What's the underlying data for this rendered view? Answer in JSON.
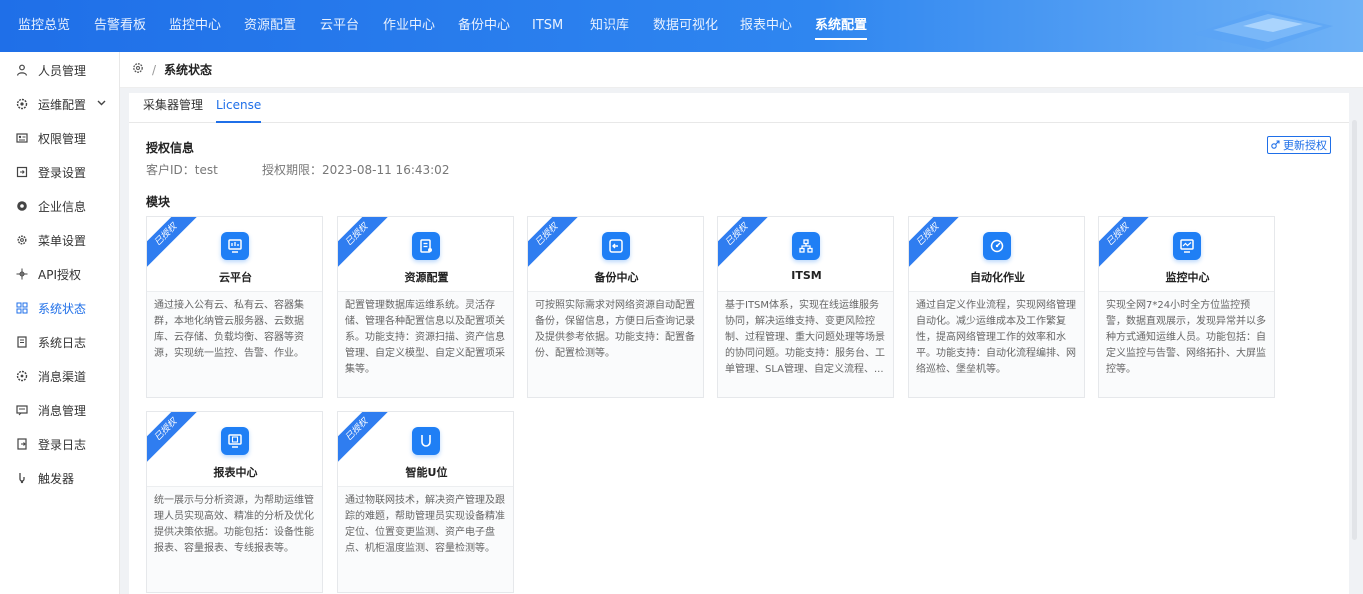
{
  "nav": {
    "items": [
      "监控总览",
      "告警看板",
      "监控中心",
      "资源配置",
      "云平台",
      "作业中心",
      "备份中心",
      "ITSM",
      "知识库",
      "数据可视化",
      "报表中心",
      "系统配置"
    ],
    "active_index": 11
  },
  "sidebar": {
    "items": [
      {
        "label": "人员管理",
        "icon": "user-icon"
      },
      {
        "label": "运维配置",
        "icon": "gear-icon"
      },
      {
        "label": "权限管理",
        "icon": "permission-icon"
      },
      {
        "label": "登录设置",
        "icon": "login-icon"
      },
      {
        "label": "企业信息",
        "icon": "company-icon"
      },
      {
        "label": "菜单设置",
        "icon": "settings-icon"
      },
      {
        "label": "API授权",
        "icon": "api-icon"
      },
      {
        "label": "系统状态",
        "icon": "grid-icon"
      },
      {
        "label": "系统日志",
        "icon": "log-icon"
      },
      {
        "label": "消息渠道",
        "icon": "channel-icon"
      },
      {
        "label": "消息管理",
        "icon": "message-icon"
      },
      {
        "label": "登录日志",
        "icon": "login-log-icon"
      },
      {
        "label": "触发器",
        "icon": "trigger-icon"
      }
    ],
    "active_index": 7,
    "expandable_index": 1
  },
  "breadcrumb": {
    "current": "系统状态"
  },
  "tabs": {
    "items": [
      "采集器管理",
      "License"
    ],
    "active_index": 1
  },
  "auth": {
    "title": "授权信息",
    "customer": "客户ID：test",
    "period": "授权期限：2023-08-11 16:43:02",
    "update_label": "更新授权"
  },
  "modules_title": "模块",
  "modules": [
    {
      "name": "云平台",
      "badge": "已授权",
      "desc": "通过接入公有云、私有云、容器集群，本地化纳管云服务器、云数据库、云存储、负载均衡、容器等资源，实现统一监控、告警、作业。"
    },
    {
      "name": "资源配置",
      "badge": "已授权",
      "desc": "配置管理数据库运维系统。灵活存储、管理各种配置信息以及配置项关系。功能支持：资源扫描、资产信息管理、自定义模型、自定义配置项采集等。"
    },
    {
      "name": "备份中心",
      "badge": "已授权",
      "desc": "可按照实际需求对网络资源自动配置备份，保留信息，方便日后查询记录及提供参考依据。功能支持：配置备份、配置检测等。"
    },
    {
      "name": "ITSM",
      "badge": "已授权",
      "desc": "基于ITSM体系，实现在线运维服务协同，解决运维支持、变更风险控制、过程管理、重大问题处理等场景的协同问题。功能支持：服务台、工单管理、SLA管理、自定义流程、..."
    },
    {
      "name": "自动化作业",
      "badge": "已授权",
      "desc": "通过自定义作业流程，实现网络管理自动化。减少运维成本及工作繁复性，提高网络管理工作的效率和水平。功能支持：自动化流程编排、网络巡检、堡垒机等。"
    },
    {
      "name": "监控中心",
      "badge": "已授权",
      "desc": "实现全网7*24小时全方位监控预警，数据直观展示，发现异常并以多种方式通知运维人员。功能包括：自定义监控与告警、网络拓扑、大屏监控等。"
    },
    {
      "name": "报表中心",
      "badge": "已授权",
      "desc": "统一展示与分析资源，为帮助运维管理人员实现高效、精准的分析及优化提供决策依据。功能包括：设备性能报表、容量报表、专线报表等。"
    },
    {
      "name": "智能U位",
      "badge": "已授权",
      "desc": "通过物联网技术，解决资产管理及跟踪的难题，帮助管理员实现设备精准定位、位置变更监测、资产电子盘点、机柜温度监测、容量检测等。"
    }
  ],
  "colors": {
    "accent": "#1f6fe8",
    "icon_bg": "#1f7ff5",
    "ribbon": "#2f7df0"
  }
}
